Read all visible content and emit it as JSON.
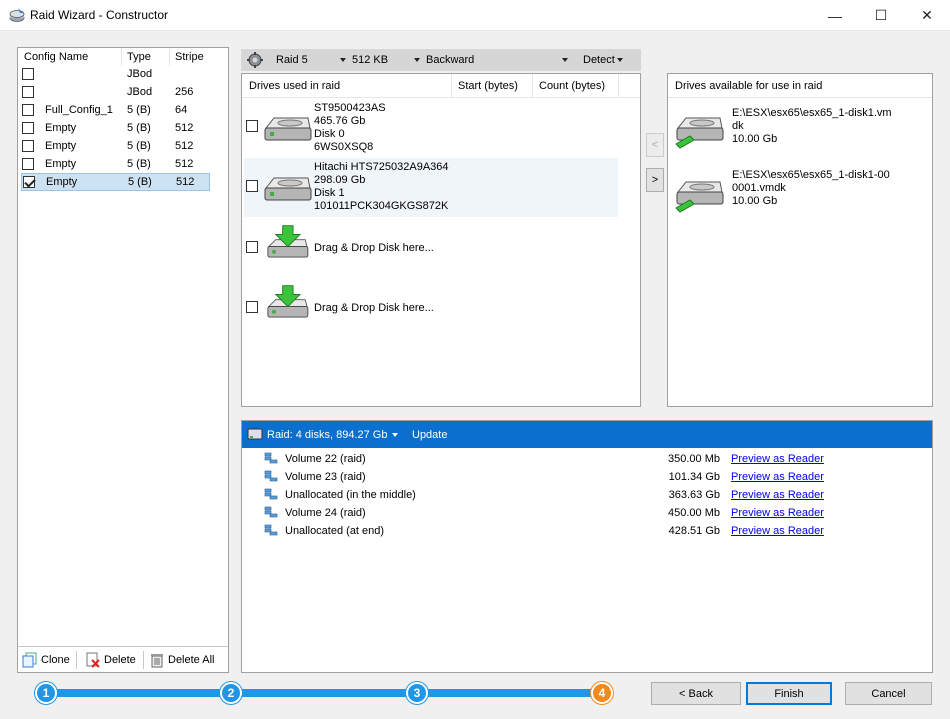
{
  "window": {
    "title": "Raid Wizard - Constructor",
    "minimize": "—",
    "maximize": "☐",
    "close": "✕"
  },
  "config_list": {
    "headers": [
      "Config Name",
      "Type",
      "Stripe"
    ],
    "rows": [
      {
        "name": "",
        "type": "JBod",
        "stripe": "",
        "checked": false
      },
      {
        "name": "",
        "type": "JBod",
        "stripe": "256",
        "checked": false
      },
      {
        "name": "Full_Config_1",
        "type": "5 (B)",
        "stripe": "64",
        "checked": false
      },
      {
        "name": "Empty",
        "type": "5 (B)",
        "stripe": "512",
        "checked": false
      },
      {
        "name": "Empty",
        "type": "5 (B)",
        "stripe": "512",
        "checked": false
      },
      {
        "name": "Empty",
        "type": "5 (B)",
        "stripe": "512",
        "checked": false
      },
      {
        "name": "Empty",
        "type": "5 (B)",
        "stripe": "512",
        "checked": true
      }
    ],
    "buttons": {
      "clone": "Clone",
      "delete": "Delete",
      "delete_all": "Delete All"
    }
  },
  "raid_toolbar": {
    "raid_type": "Raid 5",
    "stripe": "512 KB",
    "order": "Backward",
    "detect": "Detect"
  },
  "drives_used": {
    "headers": [
      "Drives used in raid",
      "Start (bytes)",
      "Count (bytes)"
    ],
    "drives": [
      {
        "l1": "ST9500423AS",
        "l2": "465.76 Gb",
        "l3": "Disk 0",
        "l4": "6WS0XSQ8"
      },
      {
        "l1": "Hitachi HTS725032A9A364",
        "l2": "298.09 Gb",
        "l3": "Disk 1",
        "l4": "101011PCK304GKGS872K"
      }
    ],
    "drop_placeholder": "Drag & Drop Disk here..."
  },
  "move_buttons": {
    "left": "<",
    "right": ">"
  },
  "drives_available": {
    "header": "Drives available for use in raid",
    "drives": [
      {
        "l1": "E:\\ESX\\esx65\\esx65_1-disk1.vm",
        "l2": "dk",
        "l3": "10.00 Gb"
      },
      {
        "l1": "E:\\ESX\\esx65\\esx65_1-disk1-00",
        "l2": "0001.vmdk",
        "l3": "10.00 Gb"
      }
    ]
  },
  "raid_summary": {
    "label": "Raid: 4 disks, 894.27 Gb",
    "update": "Update",
    "volumes": [
      {
        "name": "Volume 22 (raid)",
        "size": "350.00 Mb",
        "action": "Preview as Reader"
      },
      {
        "name": "Volume 23 (raid)",
        "size": "101.34 Gb",
        "action": "Preview as Reader"
      },
      {
        "name": "Unallocated (in the middle)",
        "size": "363.63 Gb",
        "action": "Preview as Reader"
      },
      {
        "name": "Volume 24 (raid)",
        "size": "450.00 Mb",
        "action": "Preview as Reader"
      },
      {
        "name": "Unallocated (at end)",
        "size": "428.51 Gb",
        "action": "Preview as Reader"
      }
    ]
  },
  "wizard": {
    "steps": [
      "1",
      "2",
      "3",
      "4"
    ],
    "active_step": 4,
    "back": "< Back",
    "finish": "Finish",
    "cancel": "Cancel"
  },
  "colors": {
    "accent": "#0078d7",
    "step_blue": "#2196e6",
    "step_active": "#f08a1c"
  }
}
